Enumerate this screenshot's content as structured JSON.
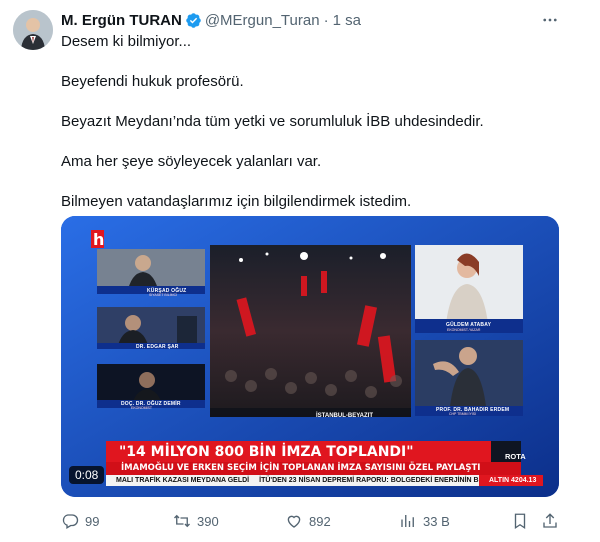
{
  "tweet": {
    "author_name": "M. Ergün TURAN",
    "handle": "@MErgun_Turan",
    "separator": "·",
    "time": "1 sa",
    "paragraphs": [
      "Desem ki bilmiyor...",
      "Beyefendi hukuk profesörü.",
      "Beyazıt Meydanı’nda tüm yetki ve sorumluluk İBB uhdesindedir.",
      "Ama her şeye söyleyecek yalanları var.",
      "Bilmeyen vatandaşlarımız için bilgilendirmek istedim."
    ]
  },
  "video": {
    "timestamp": "0:08",
    "panels": {
      "p1_name": "KÜRŞAD OĞUZ",
      "p1_title": "SİYASET BİLİMCİ",
      "p2_name": "DR. EDGAR ŞAR",
      "p3_name": "DOÇ. DR. OĞUZ DEMİR",
      "p3_title": "EKONOMİST",
      "p4_name": "GÜLDEM ATABAY",
      "p4_title": "EKONOMİST-YAZAR",
      "p5_name": "PROF. DR. BAHADIR ERDEM",
      "p5_title": "CHP TBMM İYİSİ",
      "center": "İSTANBUL-BEYAZIT"
    },
    "banner_head": "\"14 MİLYON 800 BİN İMZA TOPLANDI\"",
    "banner_sub": "İMAMOĞLU VE ERKEN SEÇİM İÇİN TOPLANAN İMZA SAYISINI ÖZEL PAYLAŞTI",
    "rota": "ROTA",
    "ticker": [
      "MALI TRAFİK KAZASI MEYDANA GELDİ",
      "İTÜ'DEN 23 NİSAN DEPREMİ RAPORU: BOLGEDEKİ ENERJİNİN B"
    ],
    "altin": "ALTIN 4204.13"
  },
  "actions": {
    "replies": "99",
    "reposts": "390",
    "likes": "892",
    "views": "33 B"
  },
  "icons": {
    "verified": "verified-badge-icon",
    "more": "more-icon",
    "reply": "reply-icon",
    "repost": "repost-icon",
    "like": "heart-icon",
    "views": "analytics-icon",
    "bookmark": "bookmark-icon",
    "share": "share-icon"
  },
  "colors": {
    "verified": "#1d9bf0",
    "muted": "#536471",
    "banner_red": "#e0161f",
    "studio_blue": "#1a55c9"
  }
}
